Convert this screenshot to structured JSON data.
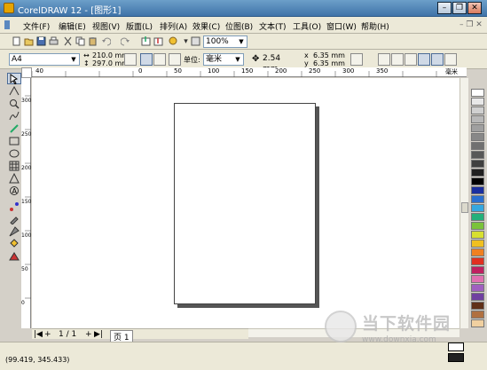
{
  "window": {
    "title": "CorelDRAW 12 - [图形1]",
    "controls": {
      "minimize": "–",
      "maximize": "❐",
      "close": "✕"
    }
  },
  "menubar": {
    "items": [
      {
        "label": "文件(F)"
      },
      {
        "label": "编辑(E)"
      },
      {
        "label": "视图(V)"
      },
      {
        "label": "版面(L)"
      },
      {
        "label": "排列(A)"
      },
      {
        "label": "效果(C)"
      },
      {
        "label": "位图(B)"
      },
      {
        "label": "文本(T)"
      },
      {
        "label": "工具(O)"
      },
      {
        "label": "窗口(W)"
      },
      {
        "label": "帮助(H)"
      }
    ]
  },
  "toolbar": {
    "zoom_value": "100%"
  },
  "propbar": {
    "paper_size": "A4",
    "width": "210.0 mm",
    "height": "297.0 mm",
    "units_label": "单位:",
    "units_value": "毫米",
    "nudge": "2.54 mm",
    "dup_x": "6.35 mm",
    "dup_y": "6.35 mm"
  },
  "ruler": {
    "h_ticks": [
      "40",
      "0",
      "50",
      "100",
      "150",
      "200",
      "250",
      "300",
      "350"
    ],
    "v_ticks": [
      "300",
      "250",
      "200",
      "150",
      "100",
      "50",
      "0"
    ],
    "unit": "毫米"
  },
  "pagenav": {
    "page_indicator": "1 / 1",
    "page_tab": "页 1"
  },
  "statusbar": {
    "coordinates": "(99.419, 345.433)"
  },
  "palette": {
    "colors": [
      "#ffffff",
      "#e8e8e8",
      "#d0d0d0",
      "#b8b8b8",
      "#a0a0a0",
      "#888888",
      "#707070",
      "#585858",
      "#404040",
      "#202020",
      "#000000",
      "#1a2fa0",
      "#2a6fd0",
      "#35a8e0",
      "#25b07a",
      "#7ac23a",
      "#d8e030",
      "#f0c020",
      "#f08020",
      "#e03020",
      "#c02060",
      "#e070b0",
      "#a060c0",
      "#7040a0",
      "#603018",
      "#b07040",
      "#f0d0a0"
    ]
  },
  "watermark": {
    "text": "当下软件园",
    "url": "www.downxia.com"
  }
}
